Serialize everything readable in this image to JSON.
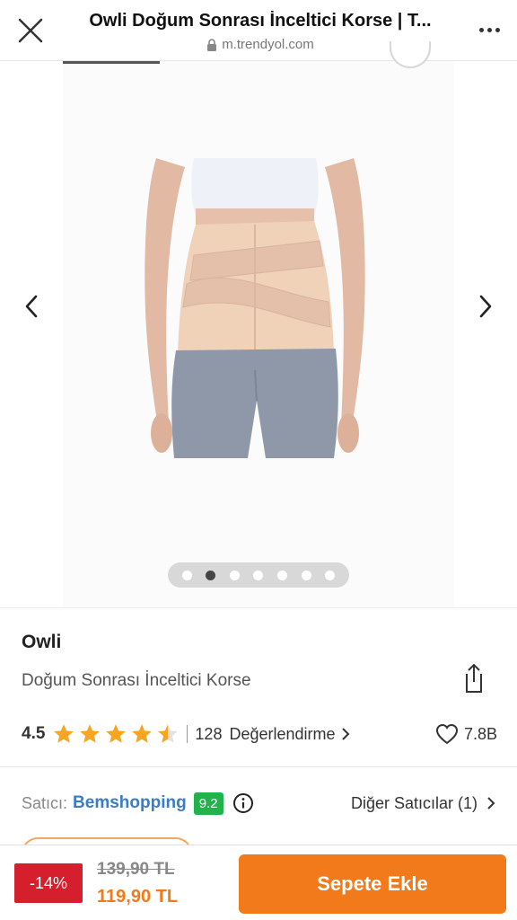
{
  "browser": {
    "title": "Owli Doğum Sonrası İnceltici Korse | T...",
    "url": "m.trendyol.com"
  },
  "gallery": {
    "image_alt": "Doğum Sonrası İnceltici Korse",
    "dot_count": 7,
    "active_dot_index": 1
  },
  "product": {
    "brand": "Owli",
    "name": "Doğum Sonrası İnceltici Korse",
    "rating": "4.5",
    "rating_value": 4.5,
    "review_count": "128",
    "review_label": "Değerlendirme",
    "favorites": "7.8B"
  },
  "seller": {
    "label": "Satıcı:",
    "name": "Bemshopping",
    "score": "9.2",
    "other_sellers": "Diğer Satıcılar (1)"
  },
  "purchase": {
    "discount": "-14%",
    "old_price": "139,90 TL",
    "new_price": "119,90 TL",
    "add_to_cart": "Sepete Ekle"
  },
  "colors": {
    "accent": "#f27a1a",
    "star": "#f6a623",
    "seller_link": "#3a7cc5",
    "score_badge": "#22b24c",
    "discount_badge": "#d51f2c"
  }
}
